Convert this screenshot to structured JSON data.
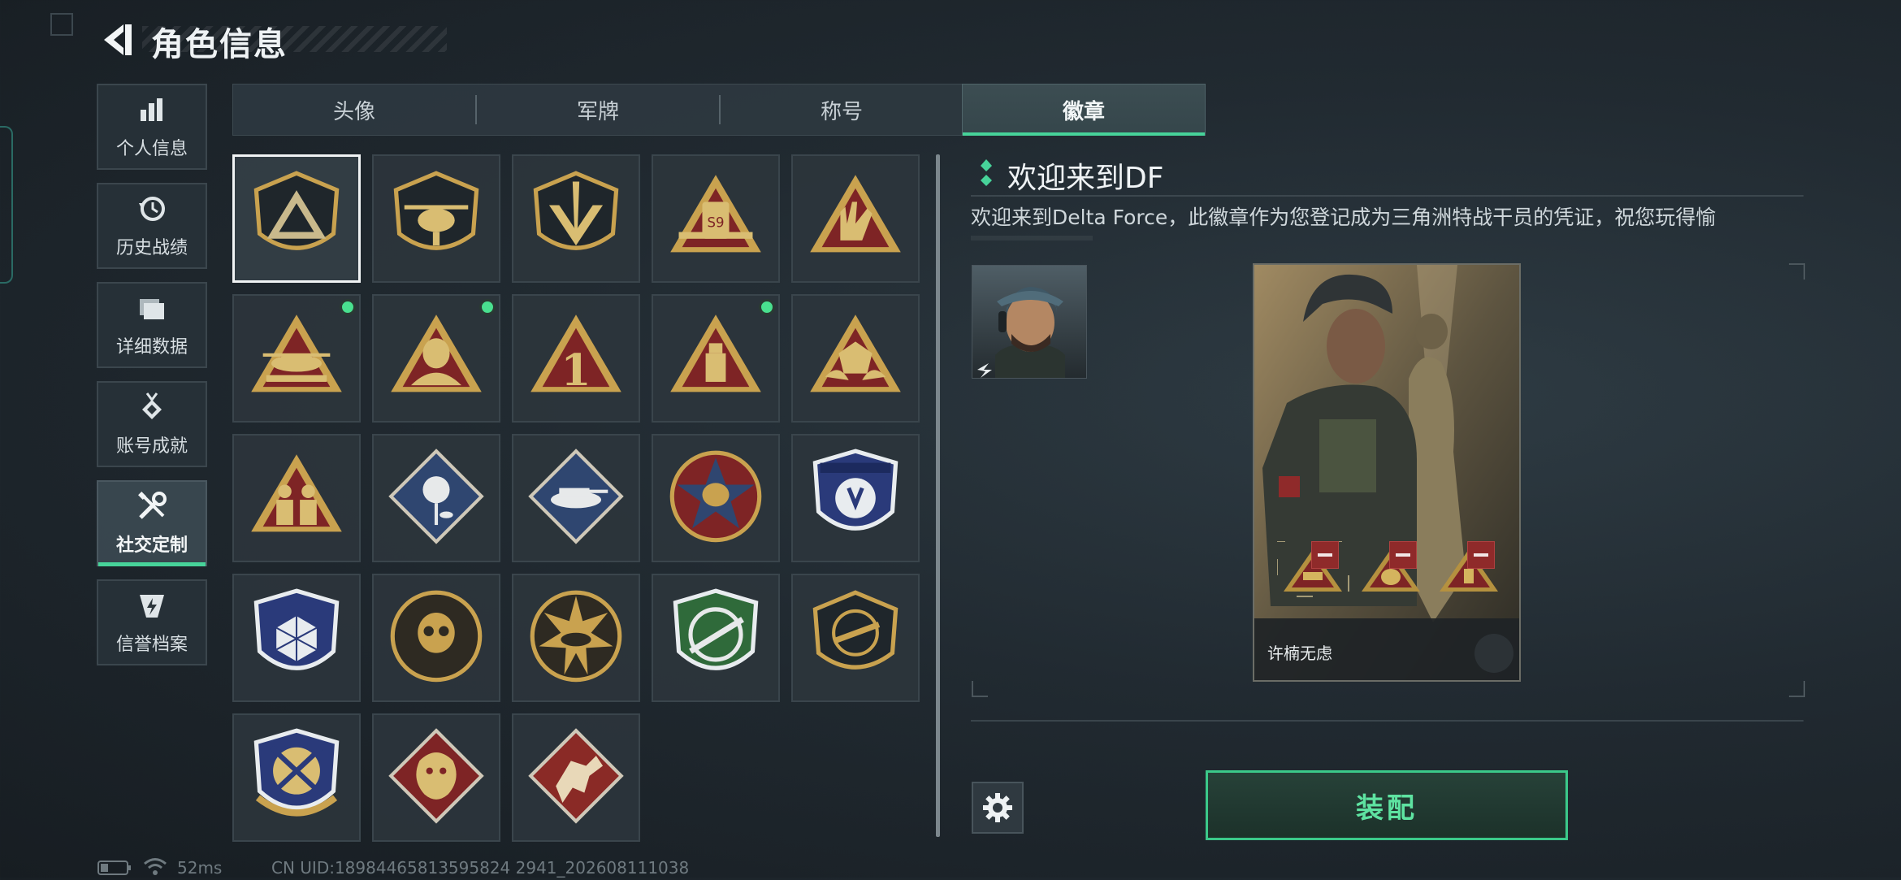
{
  "header": {
    "title": "角色信息"
  },
  "sidebar": {
    "items": [
      {
        "label": "个人信息",
        "icon": "bar-chart-icon"
      },
      {
        "label": "历史战绩",
        "icon": "history-icon"
      },
      {
        "label": "详细数据",
        "icon": "folder-icon"
      },
      {
        "label": "账号成就",
        "icon": "medal-icon"
      },
      {
        "label": "社交定制",
        "icon": "tools-icon",
        "active": true
      },
      {
        "label": "信誉档案",
        "icon": "shield-bolt-icon"
      }
    ]
  },
  "tabs": [
    {
      "label": "头像"
    },
    {
      "label": "军牌"
    },
    {
      "label": "称号"
    },
    {
      "label": "徽章",
      "active": true
    }
  ],
  "badges": [
    {
      "icon": "delta-shield-badge-icon",
      "selected": true
    },
    {
      "icon": "helicopter-shield-badge-icon"
    },
    {
      "icon": "dagger-shield-badge-icon"
    },
    {
      "icon": "s9-emblem-badge-icon"
    },
    {
      "icon": "rock-hand-triangle-badge-icon"
    },
    {
      "icon": "helicopter-triangle-badge-icon",
      "new": true
    },
    {
      "icon": "operator-triangle-badge-icon",
      "new": true
    },
    {
      "icon": "number-one-triangle-badge-icon"
    },
    {
      "icon": "usb-triangle-badge-icon",
      "new": true
    },
    {
      "icon": "dice-hands-triangle-badge-icon"
    },
    {
      "icon": "squad-triangle-badge-icon"
    },
    {
      "icon": "rose-diamond-badge-icon"
    },
    {
      "icon": "tank-diamond-badge-icon"
    },
    {
      "icon": "star-skull-round-badge-icon"
    },
    {
      "icon": "blue-shield-badge-icon"
    },
    {
      "icon": "blue-d20-shield-badge-icon"
    },
    {
      "icon": "skull-round-badge-icon"
    },
    {
      "icon": "tank-burst-round-badge-icon"
    },
    {
      "icon": "green-rifle-shield-badge-icon"
    },
    {
      "icon": "smg-shield-badge-icon"
    },
    {
      "icon": "crossed-rifles-laurel-badge-icon"
    },
    {
      "icon": "dragon-diamond-badge-icon"
    },
    {
      "icon": "runner-diamond-badge-icon"
    }
  ],
  "detail": {
    "title": "欢迎来到DF",
    "description": "欢迎来到Delta Force，此徽章作为您登记成为三角洲特战干员的凭证，祝您玩得愉",
    "card_name": "许楠无虑",
    "equip_label": "装配"
  },
  "status_bar": {
    "ping": "52ms",
    "uid": "CN UID:18984465813595824 2941_202608111038"
  },
  "colors": {
    "accent": "#47d39a",
    "badge_gold": "#c9a24f",
    "badge_red": "#7e2425",
    "new_dot": "#49e08f"
  }
}
